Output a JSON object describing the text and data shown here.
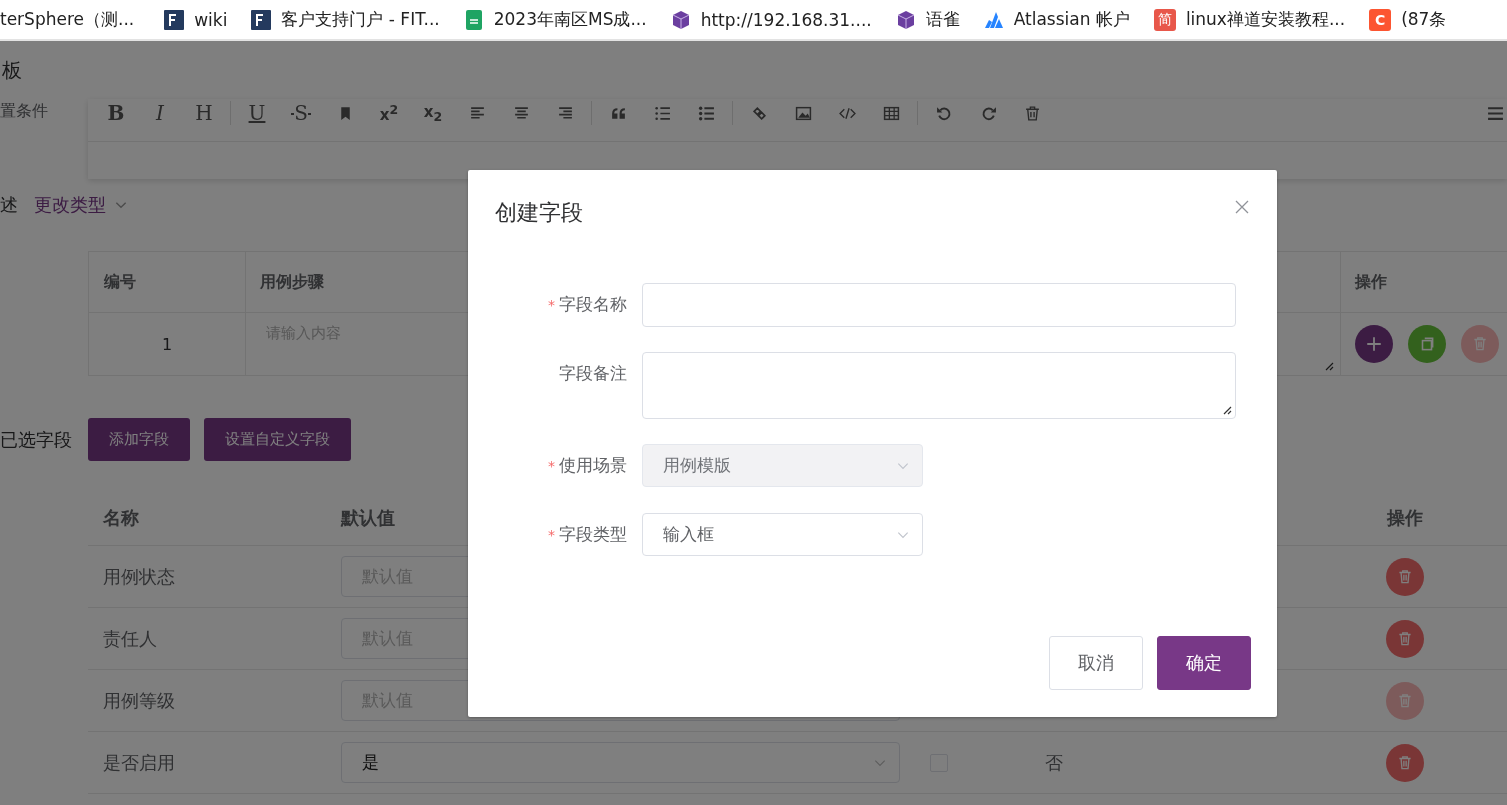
{
  "bookmarks": [
    {
      "label": "terSphere（测...",
      "kind": "none"
    },
    {
      "label": "wiki",
      "kind": "square"
    },
    {
      "label": "客户支持门户 - FIT...",
      "kind": "square"
    },
    {
      "label": "2023年南区MS成...",
      "kind": "sheet"
    },
    {
      "label": "http://192.168.31....",
      "kind": "cube"
    },
    {
      "label": "语雀",
      "kind": "cube"
    },
    {
      "label": "Atlassian 帐户",
      "kind": "triangle"
    },
    {
      "label": "linux禅道安装教程...",
      "kind": "badge",
      "badge": "简"
    },
    {
      "label": "(87条",
      "kind": "badge",
      "badge": "C"
    }
  ],
  "page": {
    "title_fragment": "板",
    "section_fragment": "置条件",
    "editor_toolbar": [
      {
        "kind": "bold",
        "label": "B"
      },
      {
        "kind": "italic",
        "label": "I"
      },
      {
        "kind": "heading",
        "label": "H"
      },
      {
        "kind": "separator"
      },
      {
        "kind": "underline",
        "label": "U"
      },
      {
        "kind": "strike",
        "label": "S"
      },
      {
        "kind": "icon"
      },
      {
        "kind": "script",
        "label": "x$^{2}$"
      },
      {
        "kind": "script",
        "label": "x$_{2}$"
      },
      {
        "kind": "icon"
      },
      {
        "kind": "icon"
      },
      {
        "kind": "icon"
      },
      {
        "kind": "separator"
      },
      {
        "kind": "icon"
      },
      {
        "kind": "icon"
      },
      {
        "kind": "icon"
      },
      {
        "kind": "separator"
      },
      {
        "kind": "icon"
      },
      {
        "kind": "icon"
      },
      {
        "kind": "icon"
      },
      {
        "kind": "icon"
      },
      {
        "kind": "separator"
      },
      {
        "kind": "icon"
      },
      {
        "kind": "icon"
      },
      {
        "kind": "icon"
      },
      {
        "kind": "icon"
      }
    ],
    "description_label": "述",
    "change_type": "更改类型",
    "steps_table": {
      "columns": [
        "编号",
        "用例步骤",
        "操作"
      ],
      "rows": [
        {
          "number": "1",
          "placeholder": "请输入内容",
          "delete_disabled": true
        }
      ]
    },
    "selected_fields_label": "已选字段",
    "buttons": [
      "添加字段",
      "设置自定义字段"
    ],
    "fields_table": {
      "columns": [
        "名称",
        "默认值",
        "操作"
      ],
      "rows": [
        {
          "name": "用例状态",
          "default": {
            "kind": "input",
            "placeholder": "默认值"
          },
          "delete_disabled": false
        },
        {
          "name": "责任人",
          "default": {
            "kind": "input",
            "placeholder": "默认值"
          },
          "delete_disabled": false
        },
        {
          "name": "用例等级",
          "default": {
            "kind": "input",
            "placeholder": "默认值"
          },
          "delete_disabled": true
        },
        {
          "name": "是否启用",
          "default": {
            "kind": "select",
            "value": "是"
          },
          "checked": false,
          "column_4": "否",
          "delete_disabled": false
        }
      ]
    }
  },
  "dialog": {
    "title": "创建字段",
    "required_mark": "*",
    "fields": [
      {
        "label": "字段名称",
        "required": true,
        "kind": "input"
      },
      {
        "label": "字段备注",
        "required": false,
        "kind": "textarea"
      },
      {
        "label": "使用场景",
        "required": true,
        "kind": "select",
        "value": "用例模版",
        "disabled": true
      },
      {
        "label": "字段类型",
        "required": true,
        "kind": "select",
        "value": "输入框",
        "disabled": false
      }
    ],
    "buttons": [
      {
        "label": "取消",
        "kind": "secondary"
      },
      {
        "label": "确定",
        "kind": "primary"
      }
    ]
  }
}
